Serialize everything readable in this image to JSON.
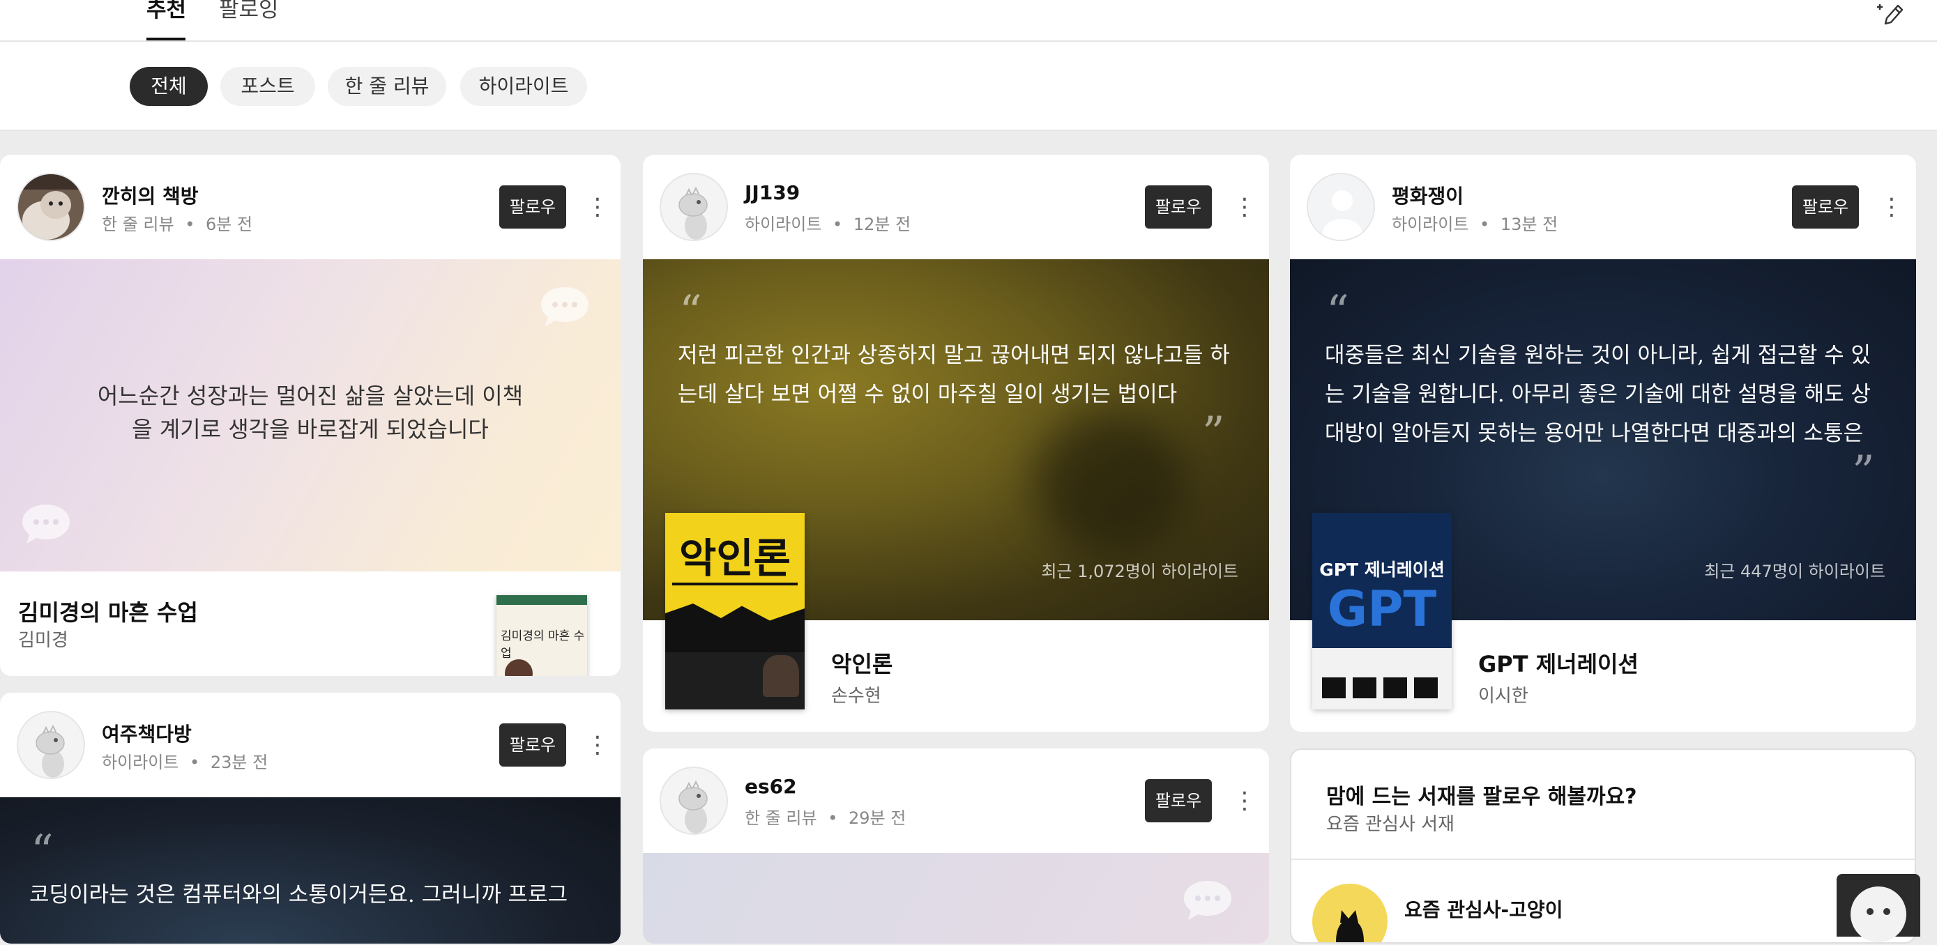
{
  "header": {
    "tabs": [
      {
        "label": "추천"
      },
      {
        "label": "팔로잉"
      }
    ]
  },
  "filters": [
    {
      "label": "전체"
    },
    {
      "label": "포스트"
    },
    {
      "label": "한 줄 리뷰"
    },
    {
      "label": "하이라이트"
    }
  ],
  "follow_label": "팔로우",
  "cards": [
    {
      "user": "깐히의 책방",
      "type": "한 줄 리뷰",
      "time": "6분 전",
      "quote": "어느순간 성장과는 멀어진 삶을 살았는데 이책을 계기로 생각을 바로잡게 되었습니다",
      "book_title": "김미경의 마흔 수업",
      "book_author": "김미경",
      "cover_title": "김미경의 마흔 수업"
    },
    {
      "user": "JJ139",
      "type": "하이라이트",
      "time": "12분 전",
      "quote_line1": "저런 피곤한 인간과 상종하지 말고 끊어내면 되지 않냐고들 하",
      "quote_line2": "는데 살다 보면 어쩔 수 없이 마주칠 일이 생기는 법이다",
      "highlight_count": "최근 1,072명이 하이라이트",
      "book_title": "악인론",
      "book_author": "손수현",
      "cover_title": "악인론"
    },
    {
      "user": "평화쟁이",
      "type": "하이라이트",
      "time": "13분 전",
      "quote_line1": "대중들은 최신 기술을 원하는 것이 아니라, 쉽게 접근할 수 있",
      "quote_line2": "는 기술을 원합니다. 아무리 좋은 기술에 대한 설명을 해도 상",
      "quote_line3": "대방이 알아듣지 못하는 용어만 나열한다면 대중과의 소통은",
      "highlight_count": "최근 447명이 하이라이트",
      "book_title": "GPT 제너레이션",
      "book_author": "이시한",
      "cover_title": "GPT 제너레이션",
      "cover_big": "GPT"
    },
    {
      "user": "여주책다방",
      "type": "하이라이트",
      "time": "23분 전",
      "quote_line1": "코딩이라는 것은 컴퓨터와의 소통이거든요. 그러니까 프로그"
    },
    {
      "user": "es62",
      "type": "한 줄 리뷰",
      "time": "29분 전"
    }
  ],
  "suggest": {
    "title": "맘에 드는 서재를 팔로우 해볼까요?",
    "subtitle": "요즘 관심사 서재",
    "item": "요즘 관심사-고양이"
  },
  "colors": {
    "dark_button": "#2b2b2b",
    "active_chip": "#2b2b2b"
  }
}
